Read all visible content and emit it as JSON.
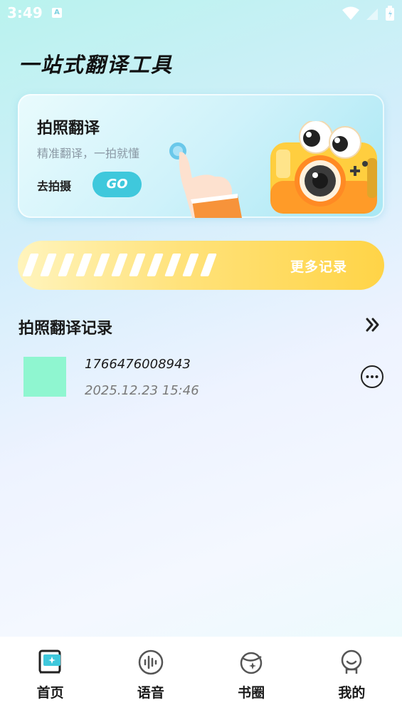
{
  "status_bar": {
    "time": "3:49",
    "indicator": "A"
  },
  "app_title": "一站式翻译工具",
  "hero": {
    "title": "拍照翻译",
    "subtitle": "精准翻译，一拍就懂",
    "go_label": "去拍摄",
    "go_button": "GO"
  },
  "more_records": {
    "label": "更多记录"
  },
  "section": {
    "title": "拍照翻译记录"
  },
  "records": [
    {
      "name": "1766476008943",
      "time": "2025.12.23 15:46",
      "thumb_color": "#8ff6d0"
    }
  ],
  "tabs": [
    {
      "label": "首页",
      "icon": "home-book-icon"
    },
    {
      "label": "语音",
      "icon": "voice-icon"
    },
    {
      "label": "书圈",
      "icon": "planet-icon"
    },
    {
      "label": "我的",
      "icon": "profile-icon"
    }
  ],
  "colors": {
    "accent": "#3fc8dc",
    "banner": "#ffd447",
    "thumb": "#8ff6d0"
  }
}
